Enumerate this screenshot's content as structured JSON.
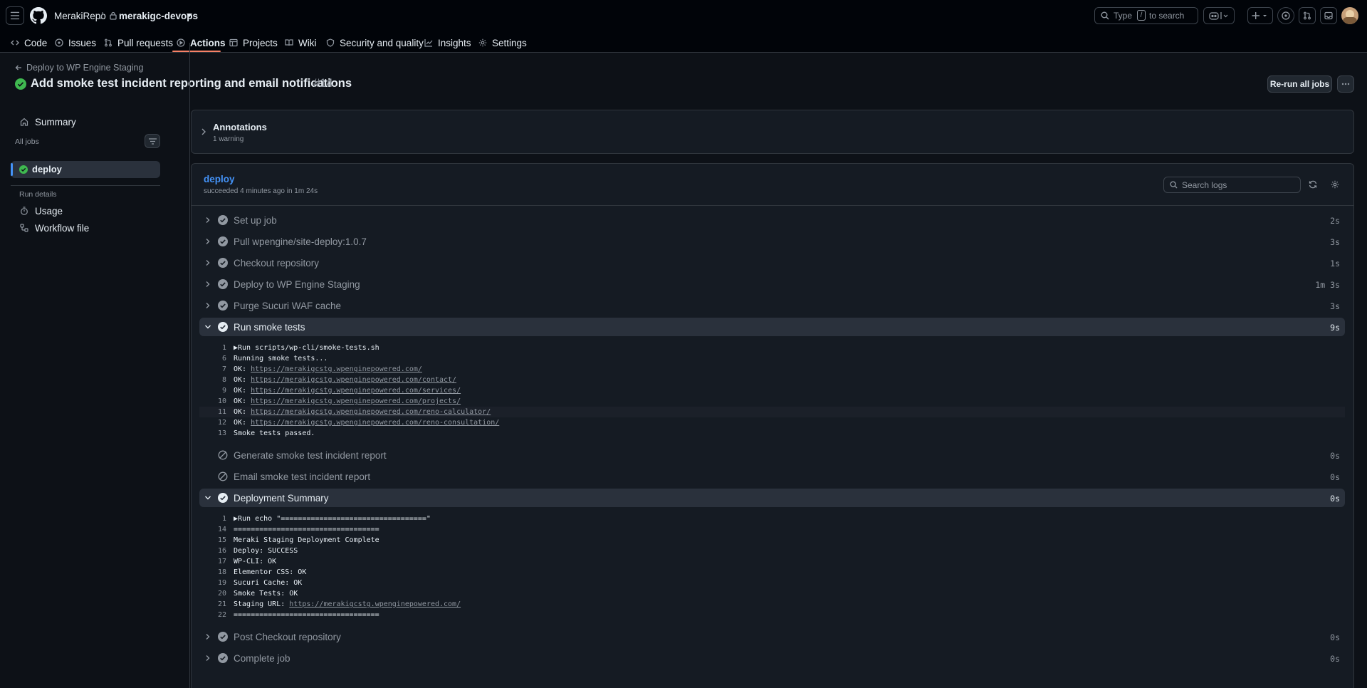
{
  "header": {
    "owner": "MerakiRepo",
    "separator": "/",
    "repo": "merakigc-devops",
    "search_prefix": "Type",
    "search_key": "/",
    "search_suffix": "to search"
  },
  "nav": {
    "code": "Code",
    "issues": "Issues",
    "pulls": "Pull requests",
    "actions": "Actions",
    "projects": "Projects",
    "wiki": "Wiki",
    "security": "Security and quality",
    "insights": "Insights",
    "settings": "Settings"
  },
  "run": {
    "back_label": "Deploy to WP Engine Staging",
    "title": "Add smoke test incident reporting and email notifications",
    "number": "#14",
    "rerun_label": "Re-run all jobs"
  },
  "sidebar": {
    "summary": "Summary",
    "all_jobs": "All jobs",
    "job": "deploy",
    "run_details": "Run details",
    "usage": "Usage",
    "workflow_file": "Workflow file"
  },
  "annotations": {
    "title": "Annotations",
    "subtitle": "1 warning"
  },
  "job": {
    "name": "deploy",
    "status": "succeeded 4 minutes ago in 1m 24s",
    "search_placeholder": "Search logs"
  },
  "steps": [
    {
      "name": "Set up job",
      "duration": "2s"
    },
    {
      "name": "Pull wpengine/site-deploy:1.0.7",
      "duration": "3s"
    },
    {
      "name": "Checkout repository",
      "duration": "1s"
    },
    {
      "name": "Deploy to WP Engine Staging",
      "duration": "1m 3s"
    },
    {
      "name": "Purge Sucuri WAF cache",
      "duration": "3s"
    },
    {
      "name": "Run smoke tests",
      "duration": "9s"
    },
    {
      "name": "Generate smoke test incident report",
      "duration": "0s"
    },
    {
      "name": "Email smoke test incident report",
      "duration": "0s"
    },
    {
      "name": "Deployment Summary",
      "duration": "0s"
    },
    {
      "name": "Post Checkout repository",
      "duration": "0s"
    },
    {
      "name": "Complete job",
      "duration": "0s"
    }
  ],
  "smoke_log": [
    {
      "n": "1",
      "text": "▶Run scripts/wp-cli/smoke-tests.sh",
      "link": ""
    },
    {
      "n": "6",
      "text": "Running smoke tests...",
      "link": ""
    },
    {
      "n": "7",
      "text": "OK: ",
      "link": "https://merakigcstg.wpenginepowered.com/"
    },
    {
      "n": "8",
      "text": "OK: ",
      "link": "https://merakigcstg.wpenginepowered.com/contact/"
    },
    {
      "n": "9",
      "text": "OK: ",
      "link": "https://merakigcstg.wpenginepowered.com/services/"
    },
    {
      "n": "10",
      "text": "OK: ",
      "link": "https://merakigcstg.wpenginepowered.com/projects/"
    },
    {
      "n": "11",
      "text": "OK: ",
      "link": "https://merakigcstg.wpenginepowered.com/reno-calculator/"
    },
    {
      "n": "12",
      "text": "OK: ",
      "link": "https://merakigcstg.wpenginepowered.com/reno-consultation/"
    },
    {
      "n": "13",
      "text": "Smoke tests passed.",
      "link": ""
    }
  ],
  "summary_log": [
    {
      "n": "1",
      "text": "▶Run echo \"==================================\"",
      "link": ""
    },
    {
      "n": "14",
      "text": "==================================",
      "link": ""
    },
    {
      "n": "15",
      "text": "Meraki Staging Deployment Complete",
      "link": ""
    },
    {
      "n": "16",
      "text": "Deploy: SUCCESS",
      "link": ""
    },
    {
      "n": "17",
      "text": "WP-CLI: OK",
      "link": ""
    },
    {
      "n": "18",
      "text": "Elementor CSS: OK",
      "link": ""
    },
    {
      "n": "19",
      "text": "Sucuri Cache: OK",
      "link": ""
    },
    {
      "n": "20",
      "text": "Smoke Tests: OK",
      "link": ""
    },
    {
      "n": "21",
      "text": "Staging URL: ",
      "link": "https://merakigcstg.wpenginepowered.com/"
    },
    {
      "n": "22",
      "text": "==================================",
      "link": ""
    }
  ]
}
